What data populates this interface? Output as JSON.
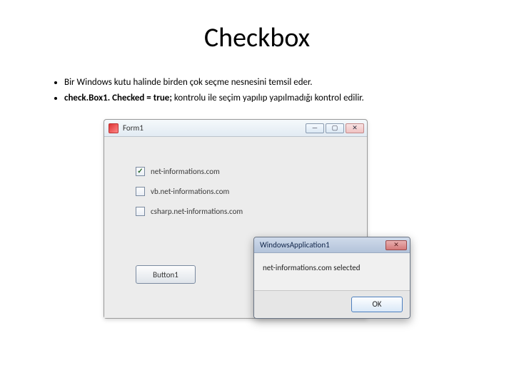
{
  "title": "Checkbox",
  "bullets": [
    "Bir Windows kutu halinde birden çok seçme nesnesini temsil eder.",
    {
      "bold": "check.Box1. Checked = true;",
      "rest": "  kontrolu ile seçim yapılıp yapılmadığı kontrol edilir."
    }
  ],
  "form": {
    "title": "Form1",
    "checkboxes": [
      {
        "label": "net-informations.com",
        "checked": true
      },
      {
        "label": "vb.net-informations.com",
        "checked": false
      },
      {
        "label": "csharp.net-informations.com",
        "checked": false
      }
    ],
    "button_label": "Button1"
  },
  "msgbox": {
    "title": "WindowsApplication1",
    "text": "net-informations.com selected",
    "ok_label": "OK"
  },
  "winbuttons": {
    "min": "—",
    "max": "▢",
    "close": "✕"
  }
}
